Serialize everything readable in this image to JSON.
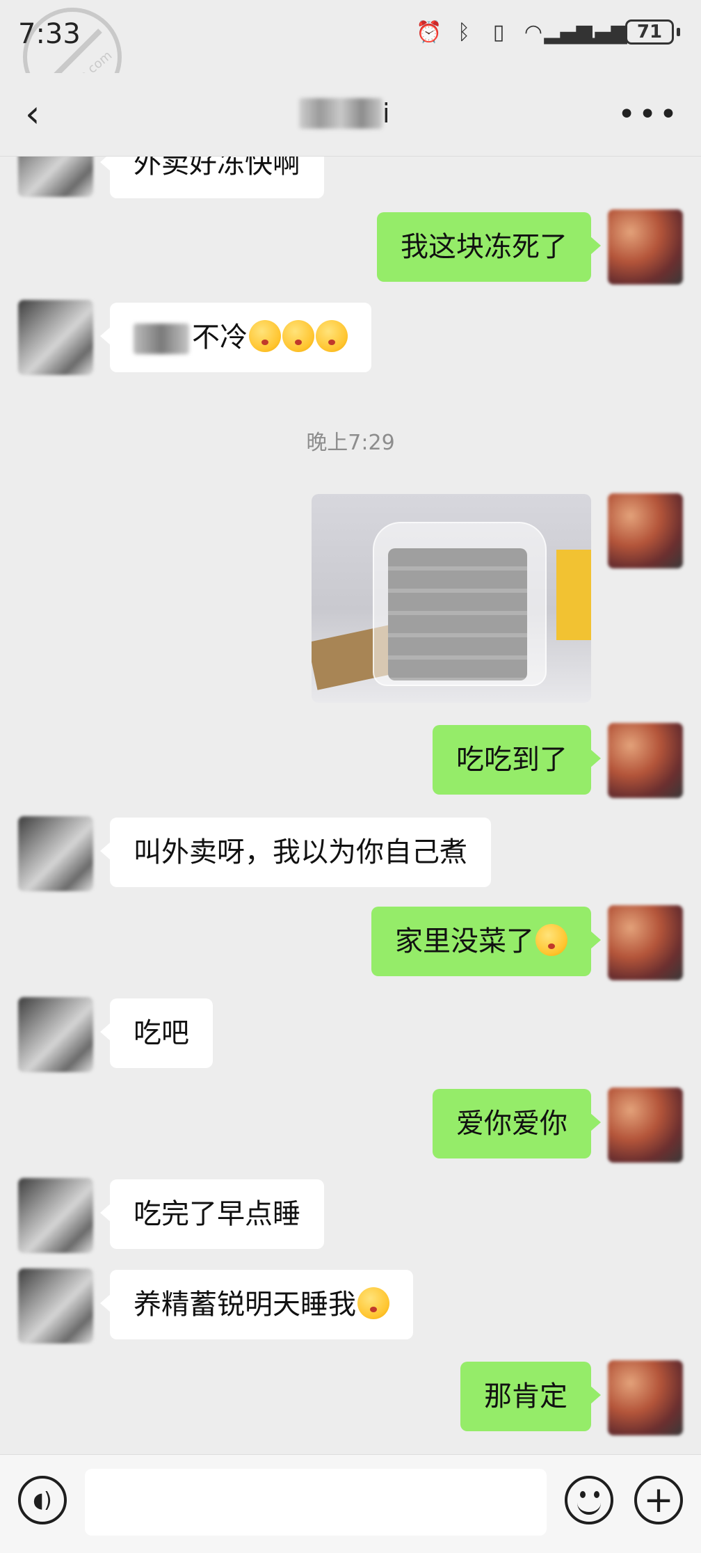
{
  "status_bar": {
    "time": "7:33",
    "battery": "71",
    "icons": [
      "alarm-icon",
      "bluetooth-icon",
      "vibrate-icon",
      "wifi-icon",
      "signal-icon",
      "signal-icon"
    ]
  },
  "header": {
    "back_icon": "back-arrow-icon",
    "title": "i",
    "more_icon": "more-icon"
  },
  "watermark": {
    "text": "laijiao.com"
  },
  "messages": [
    {
      "side": "left",
      "text": "外卖好冻快啊"
    },
    {
      "side": "right",
      "text": "我这块冻死了"
    },
    {
      "side": "left",
      "text": "不冷"
    },
    {
      "type": "timestamp",
      "text": "晚上7:29"
    },
    {
      "side": "right",
      "type": "image",
      "alt": "photo"
    },
    {
      "side": "right",
      "text": "吃吃到了"
    },
    {
      "side": "left",
      "text": "叫外卖呀，我以为你自己煮"
    },
    {
      "side": "right",
      "text": "家里没菜了"
    },
    {
      "side": "left",
      "text": "吃吧"
    },
    {
      "side": "right",
      "text": "爱你爱你"
    },
    {
      "side": "left",
      "text": "吃完了早点睡"
    },
    {
      "side": "left",
      "text": "养精蓄锐明天睡我"
    },
    {
      "side": "right",
      "text": "那肯定"
    }
  ],
  "input_bar": {
    "voice_icon": "voice-icon",
    "placeholder": "",
    "emoji_icon": "emoji-icon",
    "plus_label": "+"
  },
  "colors": {
    "background": "#ededed",
    "bubble_sent": "#95ec69",
    "bubble_received": "#ffffff"
  }
}
